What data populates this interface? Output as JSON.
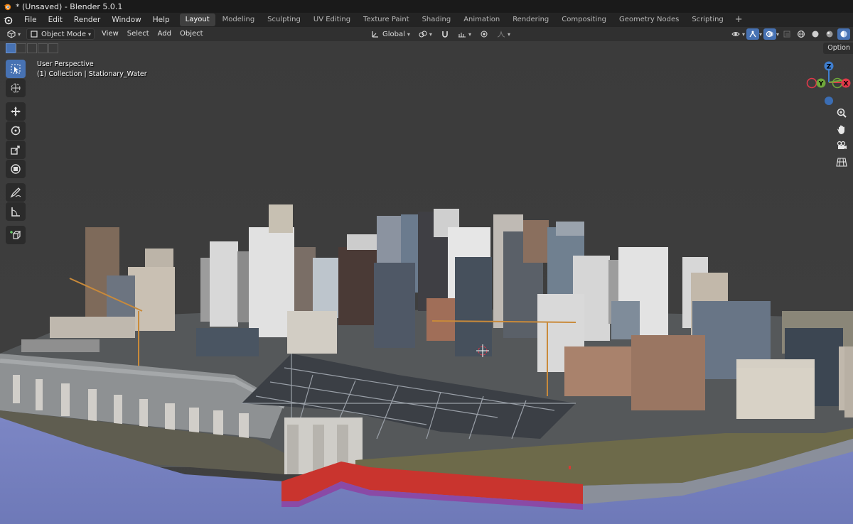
{
  "window": {
    "title": "* (Unsaved) - Blender 5.0.1"
  },
  "menu": {
    "items": [
      "File",
      "Edit",
      "Render",
      "Window",
      "Help"
    ]
  },
  "workspaces": {
    "tabs": [
      "Layout",
      "Modeling",
      "Sculpting",
      "UV Editing",
      "Texture Paint",
      "Shading",
      "Animation",
      "Rendering",
      "Compositing",
      "Geometry Nodes",
      "Scripting"
    ],
    "active": "Layout",
    "add_label": "+"
  },
  "header": {
    "mode": "Object Mode",
    "menus": [
      "View",
      "Select",
      "Add",
      "Object"
    ],
    "orientation": "Global",
    "options_label": "Option"
  },
  "viewport": {
    "perspective": "User Perspective",
    "collection": "(1) Collection | Stationary_Water",
    "gizmo": {
      "z": "Z",
      "y": "Y",
      "x": "X"
    }
  },
  "icons": {
    "editor_type": "cube-editor-icon",
    "select_box": "select-box-icon",
    "cursor": "cursor-icon",
    "move": "move-icon",
    "rotate": "rotate-icon",
    "scale": "scale-icon",
    "transform": "transform-icon",
    "annotate": "annotate-icon",
    "measure": "measure-icon",
    "add_cube": "add-cube-icon",
    "zoom": "zoom-icon",
    "pan": "hand-icon",
    "camera": "camera-icon",
    "ortho": "grid-icon"
  },
  "colors": {
    "accent": "#4772b3",
    "viewport_bg": "#3d3d3d",
    "axis_x": "#e0394a",
    "axis_y": "#6fa83b",
    "axis_z": "#3f7ecf"
  }
}
